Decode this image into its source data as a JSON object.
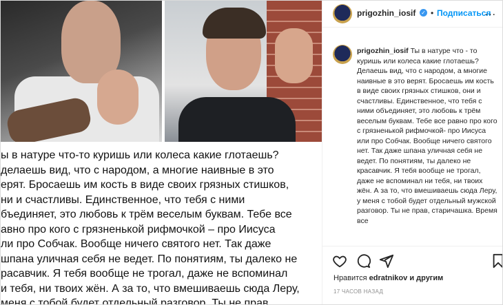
{
  "post": {
    "image_text_lines": [
      "ы в натуре что-то куришь или колеса какие глотаешь?",
      "делаешь вид, что  с народом, а многие наивные в это",
      "ерят.  Бросаешь им кость в виде своих грязных стишков,",
      "ни и счастливы. Единственное, что тебя с ними",
      "бъединяет, это любовь к трём веселым буквам. Тебе все",
      "авно про кого с грязненькой рифмочкой – про Иисуса",
      "ли про Собчак. Вообще ничего святого нет. Так даже",
      "шпана уличная себя не ведет. По понятиям, ты далеко не",
      "расавчик. Я тебя вообще не трогал, даже не вспоминал",
      "и тебя, ни твоих жён. А за то, что вмешиваешь сюда Леру,",
      "меня с тобой будет отдельный разговор. Ты не прав,"
    ]
  },
  "header": {
    "username": "prigozhin_iosif",
    "verified_mark": "✓",
    "separator": "•",
    "follow_label": "Подписаться",
    "more_label": "..."
  },
  "caption": {
    "username": "prigozhin_iosif",
    "text": "Ты в натуре что - то куришь или колеса какие глотаешь? Делаешь вид, что с народом, а многие наивные в это верят. Бросаешь им кость в виде своих грязных стишков, они и счастливы. Единственное, что тебя с ними объединяет, это любовь к трём веселым буквам. Тебе все равно про кого с грязненькой рифмочкой- про Иисуса или про Собчак. Вообще ничего святого нет. Так даже шпана уличная себя не ведет. По понятиям, ты далеко не красавчик. Я тебя вообще не трогал, даже не вспоминал ни тебя, ни твоих жён. А за то, что вмешиваешь сюда Леру, у меня с тобой будет отдельный мужской разговор. Ты не прав, старичашка. Время все"
  },
  "actions": {
    "icons": [
      "heart-icon",
      "comment-icon",
      "share-icon",
      "bookmark-icon"
    ]
  },
  "likes": {
    "prefix": "Нравится",
    "user": "edratnikov",
    "suffix": "и другим"
  },
  "timestamp": "17 ЧАСОВ НАЗАД",
  "colors": {
    "follow": "#0095f6",
    "verified": "#3897f0",
    "text": "#262626",
    "muted": "#8e8e8e"
  }
}
